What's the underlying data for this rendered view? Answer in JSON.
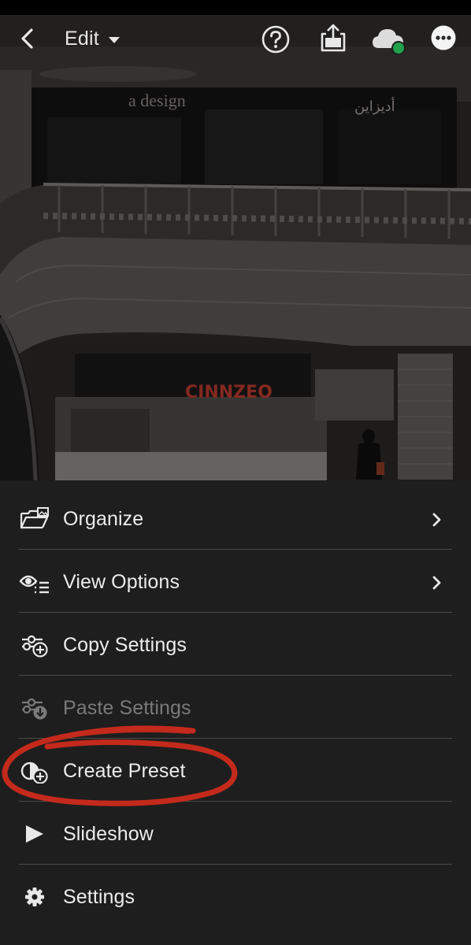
{
  "topbar": {
    "mode_label": "Edit",
    "icons": [
      "back-icon",
      "chevron-down-icon",
      "help-icon",
      "share-icon",
      "cloud-sync-icon",
      "more-icon"
    ]
  },
  "photo": {
    "sign_left": "a design",
    "sign_right": "أديزاين",
    "storefront": "CINNZEO"
  },
  "menu": {
    "items": [
      {
        "label": "Organize",
        "icon": "organize-icon",
        "has_submenu": true,
        "enabled": true
      },
      {
        "label": "View Options",
        "icon": "view-options-icon",
        "has_submenu": true,
        "enabled": true
      },
      {
        "label": "Copy Settings",
        "icon": "copy-settings-icon",
        "has_submenu": false,
        "enabled": true
      },
      {
        "label": "Paste Settings",
        "icon": "paste-settings-icon",
        "has_submenu": false,
        "enabled": false
      },
      {
        "label": "Create Preset",
        "icon": "create-preset-icon",
        "has_submenu": false,
        "enabled": true,
        "highlighted": true
      },
      {
        "label": "Slideshow",
        "icon": "play-icon",
        "has_submenu": false,
        "enabled": true
      },
      {
        "label": "Settings",
        "icon": "gear-icon",
        "has_submenu": false,
        "enabled": true
      }
    ]
  },
  "colors": {
    "menu_background": "#1e1e1e",
    "text": "#ececec",
    "disabled_text": "#7a7a7a",
    "annotation_red": "#c42a1c",
    "cloud_status_green": "#1fa34a"
  }
}
